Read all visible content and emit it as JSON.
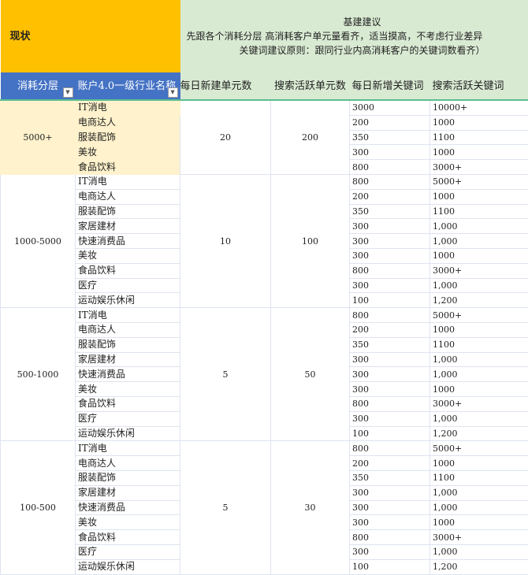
{
  "header": {
    "status_label": "现状",
    "advice_title": "基建建议",
    "advice_line1": "（单元建议原则：先跟各个消耗分层 高消耗客户单元量看齐，适当摸高，不考虑行业差异",
    "advice_line2": "关键词建议原则：跟同行业内高消耗客户的关键词数看齐）"
  },
  "columns": [
    "消耗分层",
    "账户4.0一级行业名称",
    "每日新建单元数",
    "搜索活跃单元数",
    "每日新增关键词",
    "搜索活跃关键词"
  ],
  "groups": [
    {
      "tier": "5000+",
      "new_units": "20",
      "active_units": "200",
      "rows": [
        {
          "industry": "IT消电",
          "new_kw": "3000",
          "active_kw": "10000+"
        },
        {
          "industry": "电商达人",
          "new_kw": "200",
          "active_kw": "1000"
        },
        {
          "industry": "服装配饰",
          "new_kw": "350",
          "active_kw": "1100"
        },
        {
          "industry": "美妆",
          "new_kw": "300",
          "active_kw": "1000"
        },
        {
          "industry": "食品饮料",
          "new_kw": "800",
          "active_kw": "3000+"
        }
      ]
    },
    {
      "tier": "1000-5000",
      "new_units": "10",
      "active_units": "100",
      "rows": [
        {
          "industry": "IT消电",
          "new_kw": "800",
          "active_kw": "5000+"
        },
        {
          "industry": "电商达人",
          "new_kw": "200",
          "active_kw": "1000"
        },
        {
          "industry": "服装配饰",
          "new_kw": "350",
          "active_kw": "1100"
        },
        {
          "industry": "家居建材",
          "new_kw": "300",
          "active_kw": "1,000"
        },
        {
          "industry": "快速消费品",
          "new_kw": "300",
          "active_kw": "1,000"
        },
        {
          "industry": "美妆",
          "new_kw": "300",
          "active_kw": "1000"
        },
        {
          "industry": "食品饮料",
          "new_kw": "800",
          "active_kw": "3000+"
        },
        {
          "industry": "医疗",
          "new_kw": "300",
          "active_kw": "1,000"
        },
        {
          "industry": "运动娱乐休闲",
          "new_kw": "100",
          "active_kw": "1,200"
        }
      ]
    },
    {
      "tier": "500-1000",
      "new_units": "5",
      "active_units": "50",
      "rows": [
        {
          "industry": "IT消电",
          "new_kw": "800",
          "active_kw": "5000+"
        },
        {
          "industry": "电商达人",
          "new_kw": "200",
          "active_kw": "1000"
        },
        {
          "industry": "服装配饰",
          "new_kw": "350",
          "active_kw": "1100"
        },
        {
          "industry": "家居建材",
          "new_kw": "300",
          "active_kw": "1,000"
        },
        {
          "industry": "快速消费品",
          "new_kw": "300",
          "active_kw": "1,000"
        },
        {
          "industry": "美妆",
          "new_kw": "300",
          "active_kw": "1000"
        },
        {
          "industry": "食品饮料",
          "new_kw": "800",
          "active_kw": "3000+"
        },
        {
          "industry": "医疗",
          "new_kw": "300",
          "active_kw": "1,000"
        },
        {
          "industry": "运动娱乐休闲",
          "new_kw": "100",
          "active_kw": "1,200"
        }
      ]
    },
    {
      "tier": "100-500",
      "new_units": "5",
      "active_units": "30",
      "rows": [
        {
          "industry": "IT消电",
          "new_kw": "800",
          "active_kw": "5000+"
        },
        {
          "industry": "电商达人",
          "new_kw": "200",
          "active_kw": "1000"
        },
        {
          "industry": "服装配饰",
          "new_kw": "350",
          "active_kw": "1100"
        },
        {
          "industry": "家居建材",
          "new_kw": "300",
          "active_kw": "1,000"
        },
        {
          "industry": "快速消费品",
          "new_kw": "300",
          "active_kw": "1,000"
        },
        {
          "industry": "美妆",
          "new_kw": "300",
          "active_kw": "1000"
        },
        {
          "industry": "食品饮料",
          "new_kw": "800",
          "active_kw": "3000+"
        },
        {
          "industry": "医疗",
          "new_kw": "300",
          "active_kw": "1,000"
        },
        {
          "industry": "运动娱乐休闲",
          "new_kw": "100",
          "active_kw": "1,200"
        }
      ]
    }
  ]
}
